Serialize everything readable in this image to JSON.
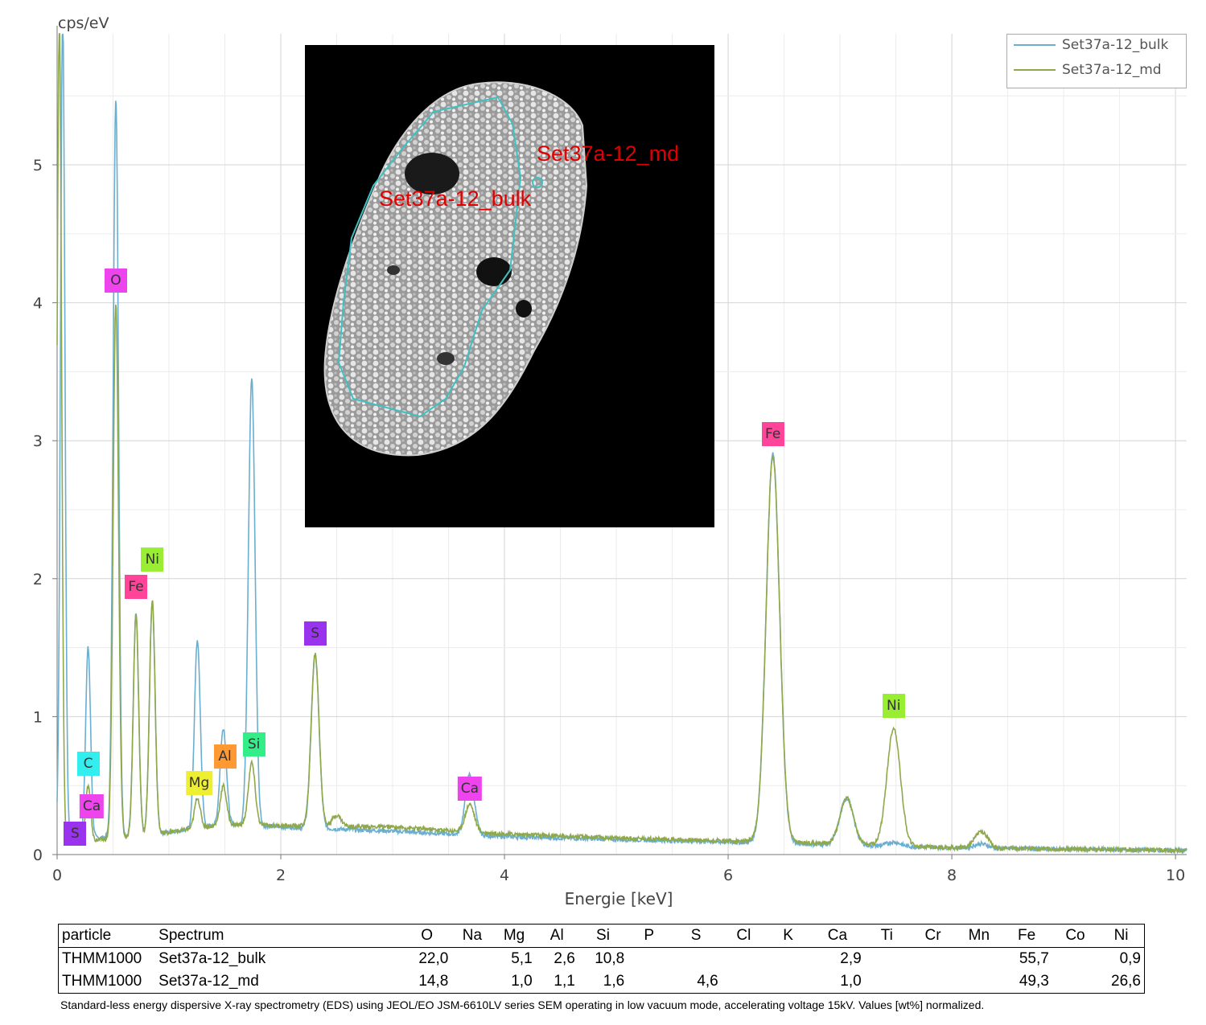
{
  "chart_data": {
    "type": "line",
    "ylabel": "cps/eV",
    "xlabel": "Energie [keV]",
    "xlim": [
      0,
      10.1
    ],
    "ylim": [
      0,
      5.95
    ],
    "x_ticks": [
      0,
      2,
      4,
      6,
      8,
      10
    ],
    "y_ticks": [
      0,
      1,
      2,
      3,
      4,
      5
    ],
    "grid": true,
    "legend_position": "top-right",
    "series": [
      {
        "name": "Set37a-12_bulk",
        "color": "#6aaed0",
        "baseline": [
          [
            0.3,
            0.12
          ],
          [
            0.8,
            0.14
          ],
          [
            1.5,
            0.22
          ],
          [
            2.0,
            0.2
          ],
          [
            3.0,
            0.17
          ],
          [
            4.0,
            0.13
          ],
          [
            5.0,
            0.11
          ],
          [
            6.0,
            0.09
          ],
          [
            7.0,
            0.07
          ],
          [
            8.0,
            0.05
          ],
          [
            9.0,
            0.04
          ],
          [
            10.1,
            0.03
          ]
        ],
        "peaks": [
          {
            "x": 0.05,
            "y": 5.95,
            "w": 0.02
          },
          {
            "x": 0.277,
            "y": 1.38,
            "w": 0.022
          },
          {
            "x": 0.525,
            "y": 5.36,
            "w": 0.024
          },
          {
            "x": 0.705,
            "y": 1.62,
            "w": 0.024
          },
          {
            "x": 0.851,
            "y": 1.68,
            "w": 0.025
          },
          {
            "x": 1.254,
            "y": 1.36,
            "w": 0.026
          },
          {
            "x": 1.486,
            "y": 0.7,
            "w": 0.028
          },
          {
            "x": 1.74,
            "y": 3.24,
            "w": 0.03
          },
          {
            "x": 2.307,
            "y": 1.26,
            "w": 0.035
          },
          {
            "x": 3.69,
            "y": 0.44,
            "w": 0.04
          },
          {
            "x": 6.4,
            "y": 2.82,
            "w": 0.06
          },
          {
            "x": 7.06,
            "y": 0.34,
            "w": 0.06
          },
          {
            "x": 7.48,
            "y": 0.03,
            "w": 0.06
          },
          {
            "x": 8.26,
            "y": 0.03,
            "w": 0.06
          }
        ]
      },
      {
        "name": "Set37a-12_md",
        "color": "#8fa84a",
        "baseline": [
          [
            0.3,
            0.1
          ],
          [
            0.8,
            0.14
          ],
          [
            1.5,
            0.22
          ],
          [
            2.0,
            0.21
          ],
          [
            3.0,
            0.2
          ],
          [
            4.0,
            0.15
          ],
          [
            5.0,
            0.12
          ],
          [
            6.0,
            0.1
          ],
          [
            7.0,
            0.08
          ],
          [
            8.0,
            0.05
          ],
          [
            9.0,
            0.04
          ],
          [
            10.1,
            0.03
          ]
        ],
        "peaks": [
          {
            "x": 0.02,
            "y": 5.95,
            "w": 0.02
          },
          {
            "x": 0.277,
            "y": 0.4,
            "w": 0.022
          },
          {
            "x": 0.525,
            "y": 3.88,
            "w": 0.024
          },
          {
            "x": 0.705,
            "y": 1.62,
            "w": 0.024
          },
          {
            "x": 0.851,
            "y": 1.7,
            "w": 0.025
          },
          {
            "x": 1.254,
            "y": 0.22,
            "w": 0.026
          },
          {
            "x": 1.486,
            "y": 0.28,
            "w": 0.028
          },
          {
            "x": 1.74,
            "y": 0.45,
            "w": 0.03
          },
          {
            "x": 2.307,
            "y": 1.25,
            "w": 0.035
          },
          {
            "x": 2.5,
            "y": 0.08,
            "w": 0.04
          },
          {
            "x": 3.69,
            "y": 0.2,
            "w": 0.04
          },
          {
            "x": 6.4,
            "y": 2.8,
            "w": 0.06
          },
          {
            "x": 7.06,
            "y": 0.33,
            "w": 0.06
          },
          {
            "x": 7.48,
            "y": 0.85,
            "w": 0.06
          },
          {
            "x": 8.26,
            "y": 0.12,
            "w": 0.06
          }
        ]
      }
    ],
    "peak_labels": [
      {
        "text": "O",
        "x": 0.525,
        "y": 4.16,
        "color": "#ee44ee"
      },
      {
        "text": "Ni",
        "x": 0.851,
        "y": 2.14,
        "color": "#99ee33"
      },
      {
        "text": "Fe",
        "x": 0.705,
        "y": 1.94,
        "color": "#ff4499"
      },
      {
        "text": "S",
        "x": 2.307,
        "y": 1.6,
        "color": "#9933ee"
      },
      {
        "text": "Fe",
        "x": 6.4,
        "y": 3.05,
        "color": "#ff4499"
      },
      {
        "text": "Ni",
        "x": 7.48,
        "y": 1.08,
        "color": "#99ee33"
      },
      {
        "text": "C",
        "x": 0.277,
        "y": 0.66,
        "color": "#33eeee"
      },
      {
        "text": "Ca",
        "x": 0.31,
        "y": 0.35,
        "color": "#ee44ee"
      },
      {
        "text": "S",
        "x": 0.16,
        "y": 0.15,
        "color": "#9933ee"
      },
      {
        "text": "Mg",
        "x": 1.27,
        "y": 0.52,
        "color": "#eeee33"
      },
      {
        "text": "Al",
        "x": 1.5,
        "y": 0.71,
        "color": "#ff9933"
      },
      {
        "text": "Si",
        "x": 1.76,
        "y": 0.8,
        "color": "#33ee88"
      },
      {
        "text": "Ca",
        "x": 3.69,
        "y": 0.48,
        "color": "#ee44ee"
      }
    ]
  },
  "sem_image": {
    "label_md": "Set37a-12_md",
    "label_bulk": "Set37a-12_bulk",
    "outline_color": "#40c0c0"
  },
  "table": {
    "headers": [
      "particle",
      "Spectrum",
      "O",
      "Na",
      "Mg",
      "Al",
      "Si",
      "P",
      "S",
      "Cl",
      "K",
      "Ca",
      "Ti",
      "Cr",
      "Mn",
      "Fe",
      "Co",
      "Ni"
    ],
    "rows": [
      [
        "THMM1000",
        "Set37a-12_bulk",
        "22,0",
        "",
        "5,1",
        "2,6",
        "10,8",
        "",
        "",
        "",
        "",
        "2,9",
        "",
        "",
        "",
        "55,7",
        "",
        "0,9"
      ],
      [
        "THMM1000",
        "Set37a-12_md",
        "14,8",
        "",
        "1,0",
        "1,1",
        "1,6",
        "",
        "4,6",
        "",
        "",
        "1,0",
        "",
        "",
        "",
        "49,3",
        "",
        "26,6"
      ]
    ]
  },
  "footnote": "Standard-less energy dispersive X-ray spectrometry (EDS) using JEOL/EO JSM-6610LV series SEM operating in low vacuum mode, accelerating voltage 15kV. Values [wt%] normalized."
}
